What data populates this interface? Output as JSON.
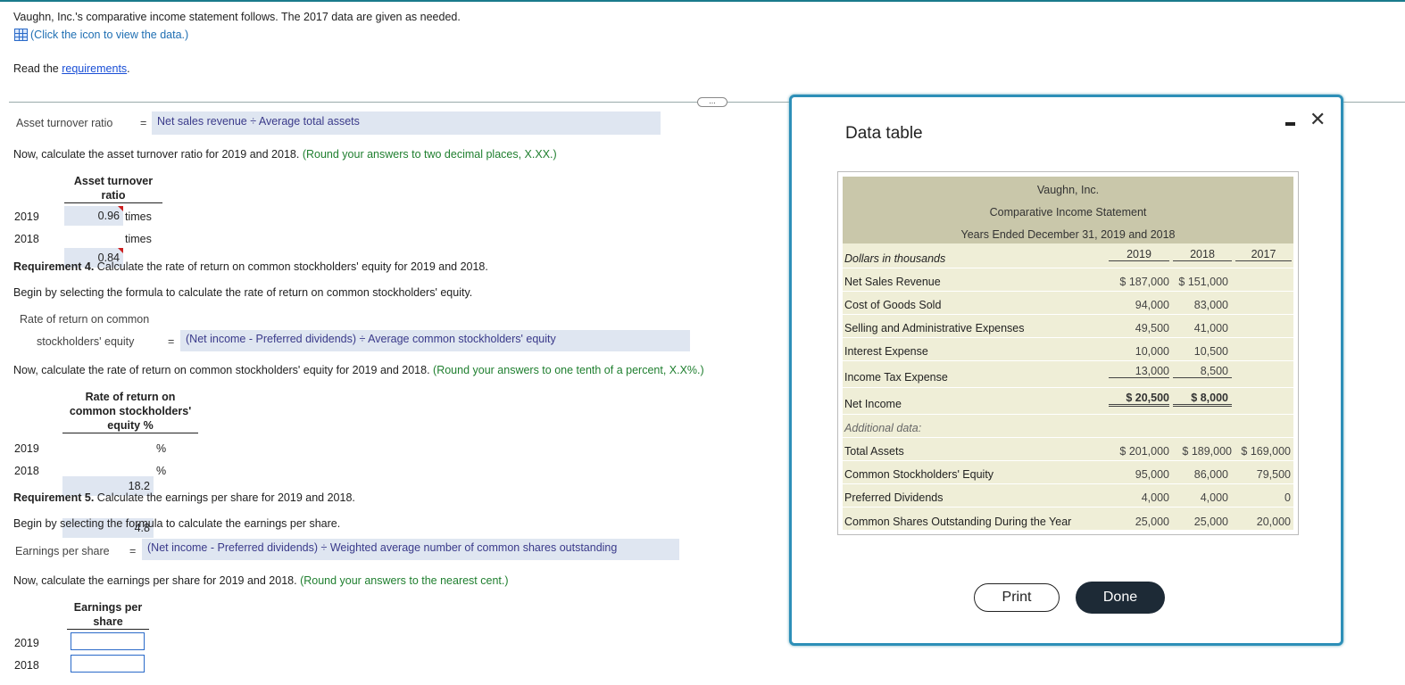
{
  "intro": {
    "text": "Vaughn, Inc.'s comparative income statement follows. The 2017 data are given as needed.",
    "click_icon_text": "(Click the icon to view the data.)",
    "read_prefix": "Read the ",
    "requirements_link": "requirements",
    "read_suffix": "."
  },
  "asset_turnover_formula": {
    "label": "Asset turnover ratio",
    "equals": "=",
    "formula": "Net sales revenue ÷ Average total assets"
  },
  "asset_turnover_calc": {
    "instruction": "Now, calculate the asset turnover ratio for 2019 and 2018.",
    "round_note": "(Round your answers to two decimal places, X.XX.)",
    "header_line1": "Asset turnover",
    "header_line2": "ratio",
    "rows": [
      {
        "year": "2019",
        "value": "0.96",
        "unit": "times"
      },
      {
        "year": "2018",
        "value": "0.84",
        "unit": "times"
      }
    ]
  },
  "req4": {
    "title_bold": "Requirement 4.",
    "title_rest": " Calculate the rate of return on common stockholders' equity for 2019 and 2018.",
    "select_text": "Begin by selecting the formula to calculate the rate of return on common stockholders' equity.",
    "label_line1": "Rate of return on common",
    "label_line2": "stockholders' equity",
    "equals": "=",
    "formula": "(Net income - Preferred dividends) ÷ Average common stockholders' equity",
    "instruction": "Now, calculate the rate of return on common stockholders' equity for 2019 and 2018.",
    "round_note": "(Round your answers to one tenth of a percent, X.X%.)",
    "header_line1": "Rate of return on",
    "header_line2": "common stockholders'",
    "header_line3": "equity %",
    "rows": [
      {
        "year": "2019",
        "value": "18.2",
        "unit": "%"
      },
      {
        "year": "2018",
        "value": "4.8",
        "unit": "%"
      }
    ]
  },
  "req5": {
    "title_bold": "Requirement 5.",
    "title_rest": " Calculate the earnings per share for 2019 and 2018.",
    "select_text": "Begin by selecting the formula to calculate the earnings per share.",
    "label": "Earnings per share",
    "equals": "=",
    "formula": "(Net income - Preferred dividends) ÷ Weighted average number of common shares outstanding",
    "instruction": "Now, calculate the earnings per share for 2019 and 2018.",
    "round_note": "(Round your answers to the nearest cent.)",
    "header_line1": "Earnings per",
    "header_line2": "share",
    "rows": [
      {
        "year": "2019",
        "value": ""
      },
      {
        "year": "2018",
        "value": ""
      }
    ]
  },
  "more_button": "...",
  "modal": {
    "title": "Data table",
    "minimize_icon": "minimize-icon",
    "close_icon": "close-icon",
    "close_glyph": "✕",
    "table": {
      "company": "Vaughn, Inc.",
      "statement": "Comparative Income Statement",
      "period": "Years Ended December 31, 2019 and 2018",
      "units_label": "Dollars in thousands",
      "years": [
        "2019",
        "2018",
        "2017"
      ],
      "rows": [
        {
          "label": "Net Sales Revenue",
          "c2019": "$  187,000",
          "c2018": "$  151,000",
          "c2017": ""
        },
        {
          "label": "Cost of Goods Sold",
          "c2019": "94,000",
          "c2018": "83,000",
          "c2017": ""
        },
        {
          "label": "Selling and Administrative Expenses",
          "c2019": "49,500",
          "c2018": "41,000",
          "c2017": ""
        },
        {
          "label": "Interest Expense",
          "c2019": "10,000",
          "c2018": "10,500",
          "c2017": ""
        },
        {
          "label": "Income Tax Expense",
          "c2019": "13,000",
          "c2018": "8,500",
          "c2017": ""
        },
        {
          "label": "Net Income",
          "c2019": "$    20,500",
          "c2018": "$      8,000",
          "c2017": ""
        },
        {
          "label": "Additional data:",
          "c2019": "",
          "c2018": "",
          "c2017": ""
        },
        {
          "label": "Total Assets",
          "c2019": "$  201,000",
          "c2018": "$  189,000",
          "c2017": "$  169,000"
        },
        {
          "label": "Common Stockholders' Equity",
          "c2019": "95,000",
          "c2018": "86,000",
          "c2017": "79,500"
        },
        {
          "label": "Preferred Dividends",
          "c2019": "4,000",
          "c2018": "4,000",
          "c2017": "0"
        },
        {
          "label": "Common Shares Outstanding During the Year",
          "c2019": "25,000",
          "c2018": "25,000",
          "c2017": "20,000"
        }
      ]
    },
    "print_button": "Print",
    "done_button": "Done"
  },
  "colors": {
    "accent_blue": "#2a6ac9",
    "instruction_green": "#1f7f2f",
    "answer_bg": "#dfe6f1",
    "table_header_bg": "#c9c7aa",
    "table_body_bg": "#efeed7",
    "modal_border": "#2d8fb8",
    "done_bg": "#1d2a36"
  }
}
